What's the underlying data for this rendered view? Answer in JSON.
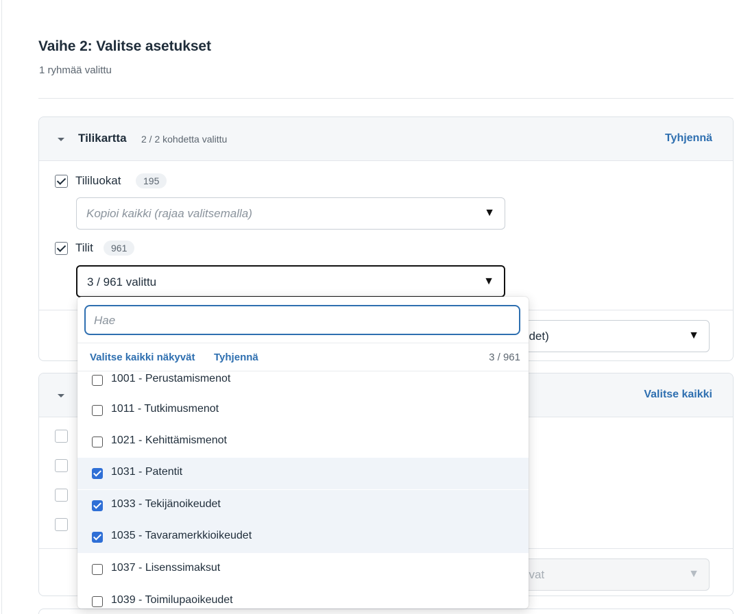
{
  "step": {
    "title": "Vaihe 2: Valitse asetukset",
    "subtitle": "1 ryhmää valittu"
  },
  "section1": {
    "title": "Tilikartta",
    "count": "2 / 2 kohdetta valittu",
    "action": "Tyhjennä",
    "rows": [
      {
        "label": "Tililuokat",
        "badge": "195",
        "checked": true,
        "select_placeholder": "Kopioi kaikki (rajaa valitsemalla)"
      },
      {
        "label": "Tilit",
        "badge": "961",
        "checked": true,
        "select_value": "3 / 961 valittu"
      }
    ],
    "partial_select_text": "udet)"
  },
  "section2": {
    "action": "Valitse kaikki",
    "partial_select_text": "evat"
  },
  "dropdown": {
    "search_placeholder": "Hae",
    "select_all_visible": "Valitse kaikki näkyvät",
    "clear": "Tyhjennä",
    "count": "3 / 961",
    "items": [
      {
        "label": "1001 - Perustamismenot",
        "checked": false
      },
      {
        "label": "1011 - Tutkimusmenot",
        "checked": false
      },
      {
        "label": "1021 - Kehittämismenot",
        "checked": false
      },
      {
        "label": "1031 - Patentit",
        "checked": true
      },
      {
        "label": "1033 - Tekijänoikeudet",
        "checked": true
      },
      {
        "label": "1035 - Tavaramerkkioikeudet",
        "checked": true
      },
      {
        "label": "1037 - Lisenssimaksut",
        "checked": false
      },
      {
        "label": "1039 - Toimilupaoikeudet",
        "checked": false
      }
    ]
  },
  "icons": {
    "dropdown_arrow": "▼",
    "accent_color": "#2e6fb0",
    "checkbox_checked_color": "#2f6fd6"
  }
}
